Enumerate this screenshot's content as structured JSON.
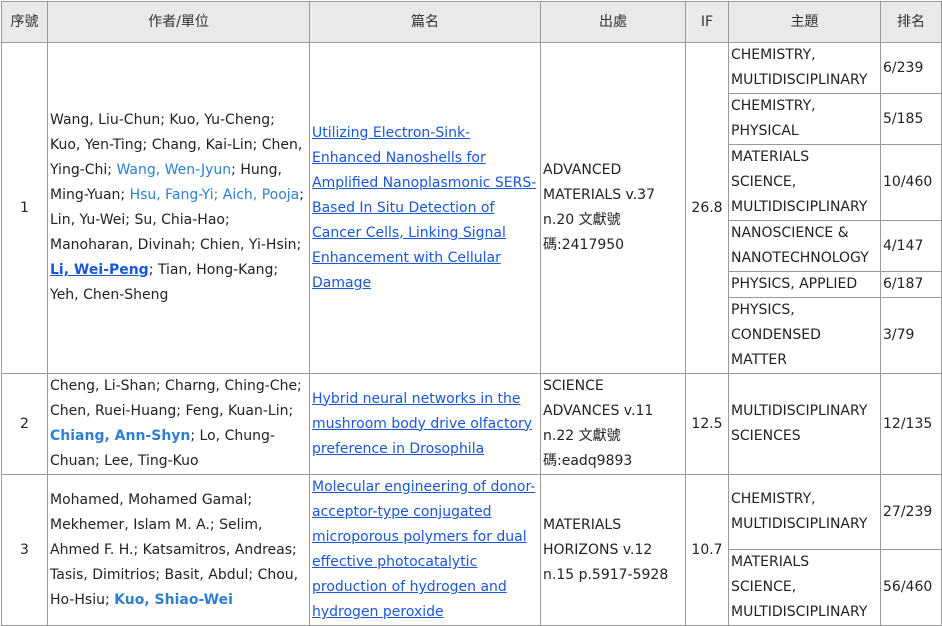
{
  "headers": {
    "no": "序號",
    "authors": "作者/單位",
    "title": "篇名",
    "source": "出處",
    "if": "IF",
    "topic": "主題",
    "rank": "排名"
  },
  "rows": [
    {
      "no": "1",
      "authors": [
        {
          "t": "Wang, Liu-Chun; Kuo, Yu-Cheng; Kuo, Yen-Ting; Chang, Kai-Lin; Chen, Ying-Chi; ",
          "s": "plain"
        },
        {
          "t": "Wang, Wen-Jyun",
          "s": "hl"
        },
        {
          "t": "; Hung, Ming-Yuan; ",
          "s": "plain"
        },
        {
          "t": "Hsu, Fang-Yi; Aich, Pooja",
          "s": "hl"
        },
        {
          "t": "; Lin, Yu-Wei; Su, Chia-Hao; Manoharan, Divinah; Chien, Yi-Hsin; ",
          "s": "plain"
        },
        {
          "t": "Li, Wei-Peng",
          "s": "hl-bl"
        },
        {
          "t": "; Tian, Hong-Kang; Yeh, Chen-Sheng",
          "s": "plain"
        }
      ],
      "title": "Utilizing Electron-Sink-Enhanced Nanoshells for Amplified Nanoplasmonic SERS-Based In Situ Detection of Cancer Cells, Linking Signal Enhancement with Cellular Damage",
      "source": "ADVANCED MATERIALS v.37 n.20 文獻號碼:2417950",
      "if": "26.8",
      "topics": [
        {
          "topic": "CHEMISTRY, MULTIDISCIPLINARY",
          "rank": "6/239"
        },
        {
          "topic": "CHEMISTRY, PHYSICAL",
          "rank": "5/185"
        },
        {
          "topic": "MATERIALS SCIENCE, MULTIDISCIPLINARY",
          "rank": "10/460"
        },
        {
          "topic": "NANOSCIENCE & NANOTECHNOLOGY",
          "rank": "4/147"
        },
        {
          "topic": "PHYSICS, APPLIED",
          "rank": "6/187"
        },
        {
          "topic": "PHYSICS, CONDENSED MATTER",
          "rank": "3/79"
        }
      ]
    },
    {
      "no": "2",
      "authors": [
        {
          "t": "Cheng, Li-Shan; Charng, Ching-Che; Chen, Ruei-Huang; Feng, Kuan-Lin; ",
          "s": "plain"
        },
        {
          "t": "Chiang, Ann-Shyn",
          "s": "hl-b"
        },
        {
          "t": "; Lo, Chung-Chuan; Lee, Ting-Kuo",
          "s": "plain"
        }
      ],
      "title": "Hybrid neural networks in the mushroom body drive olfactory preference in Drosophila",
      "source": "SCIENCE ADVANCES v.11 n.22 文獻號碼:eadq9893",
      "if": "12.5",
      "topics": [
        {
          "topic": "MULTIDISCIPLINARY SCIENCES",
          "rank": "12/135"
        }
      ]
    },
    {
      "no": "3",
      "authors": [
        {
          "t": "Mohamed, Mohamed Gamal; Mekhemer, Islam M. A.; Selim, Ahmed F. H.; Katsamitros, Andreas; Tasis, Dimitrios; Basit, Abdul; Chou, Ho-Hsiu; ",
          "s": "plain"
        },
        {
          "t": "Kuo, Shiao-Wei",
          "s": "hl-b"
        }
      ],
      "title": "Molecular engineering of donor-acceptor-type conjugated microporous polymers for dual effective photocatalytic production of hydrogen and hydrogen peroxide",
      "source": "MATERIALS HORIZONS v.12 n.15 p.5917-5928",
      "if": "10.7",
      "topics": [
        {
          "topic": "CHEMISTRY, MULTIDISCIPLINARY",
          "rank": "27/239"
        },
        {
          "topic": "MATERIALS SCIENCE, MULTIDISCIPLINARY",
          "rank": "56/460"
        }
      ]
    }
  ]
}
